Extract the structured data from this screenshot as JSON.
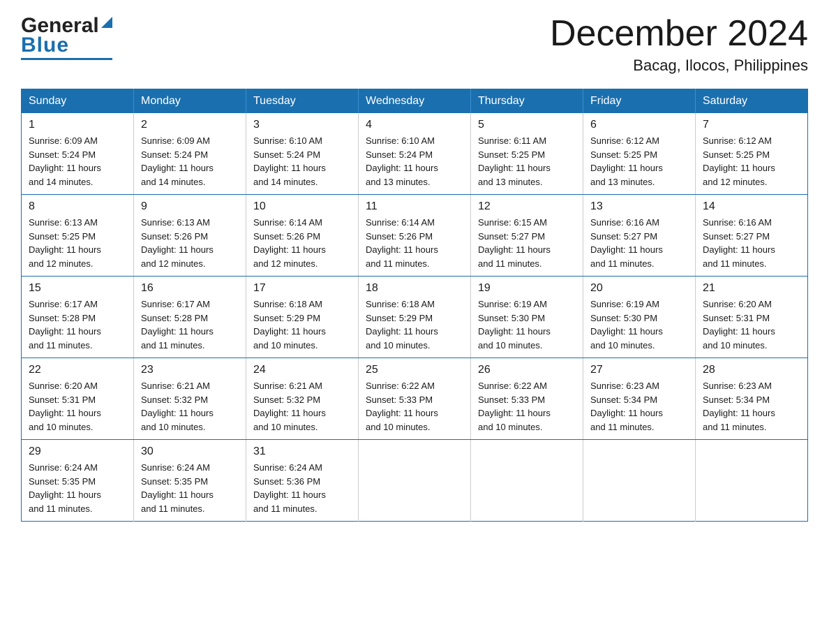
{
  "header": {
    "logo_general": "General",
    "logo_blue": "Blue",
    "month_title": "December 2024",
    "location": "Bacag, Ilocos, Philippines"
  },
  "days_of_week": [
    "Sunday",
    "Monday",
    "Tuesday",
    "Wednesday",
    "Thursday",
    "Friday",
    "Saturday"
  ],
  "weeks": [
    [
      {
        "day": "1",
        "sunrise": "6:09 AM",
        "sunset": "5:24 PM",
        "daylight": "11 hours and 14 minutes."
      },
      {
        "day": "2",
        "sunrise": "6:09 AM",
        "sunset": "5:24 PM",
        "daylight": "11 hours and 14 minutes."
      },
      {
        "day": "3",
        "sunrise": "6:10 AM",
        "sunset": "5:24 PM",
        "daylight": "11 hours and 14 minutes."
      },
      {
        "day": "4",
        "sunrise": "6:10 AM",
        "sunset": "5:24 PM",
        "daylight": "11 hours and 13 minutes."
      },
      {
        "day": "5",
        "sunrise": "6:11 AM",
        "sunset": "5:25 PM",
        "daylight": "11 hours and 13 minutes."
      },
      {
        "day": "6",
        "sunrise": "6:12 AM",
        "sunset": "5:25 PM",
        "daylight": "11 hours and 13 minutes."
      },
      {
        "day": "7",
        "sunrise": "6:12 AM",
        "sunset": "5:25 PM",
        "daylight": "11 hours and 12 minutes."
      }
    ],
    [
      {
        "day": "8",
        "sunrise": "6:13 AM",
        "sunset": "5:25 PM",
        "daylight": "11 hours and 12 minutes."
      },
      {
        "day": "9",
        "sunrise": "6:13 AM",
        "sunset": "5:26 PM",
        "daylight": "11 hours and 12 minutes."
      },
      {
        "day": "10",
        "sunrise": "6:14 AM",
        "sunset": "5:26 PM",
        "daylight": "11 hours and 12 minutes."
      },
      {
        "day": "11",
        "sunrise": "6:14 AM",
        "sunset": "5:26 PM",
        "daylight": "11 hours and 11 minutes."
      },
      {
        "day": "12",
        "sunrise": "6:15 AM",
        "sunset": "5:27 PM",
        "daylight": "11 hours and 11 minutes."
      },
      {
        "day": "13",
        "sunrise": "6:16 AM",
        "sunset": "5:27 PM",
        "daylight": "11 hours and 11 minutes."
      },
      {
        "day": "14",
        "sunrise": "6:16 AM",
        "sunset": "5:27 PM",
        "daylight": "11 hours and 11 minutes."
      }
    ],
    [
      {
        "day": "15",
        "sunrise": "6:17 AM",
        "sunset": "5:28 PM",
        "daylight": "11 hours and 11 minutes."
      },
      {
        "day": "16",
        "sunrise": "6:17 AM",
        "sunset": "5:28 PM",
        "daylight": "11 hours and 11 minutes."
      },
      {
        "day": "17",
        "sunrise": "6:18 AM",
        "sunset": "5:29 PM",
        "daylight": "11 hours and 10 minutes."
      },
      {
        "day": "18",
        "sunrise": "6:18 AM",
        "sunset": "5:29 PM",
        "daylight": "11 hours and 10 minutes."
      },
      {
        "day": "19",
        "sunrise": "6:19 AM",
        "sunset": "5:30 PM",
        "daylight": "11 hours and 10 minutes."
      },
      {
        "day": "20",
        "sunrise": "6:19 AM",
        "sunset": "5:30 PM",
        "daylight": "11 hours and 10 minutes."
      },
      {
        "day": "21",
        "sunrise": "6:20 AM",
        "sunset": "5:31 PM",
        "daylight": "11 hours and 10 minutes."
      }
    ],
    [
      {
        "day": "22",
        "sunrise": "6:20 AM",
        "sunset": "5:31 PM",
        "daylight": "11 hours and 10 minutes."
      },
      {
        "day": "23",
        "sunrise": "6:21 AM",
        "sunset": "5:32 PM",
        "daylight": "11 hours and 10 minutes."
      },
      {
        "day": "24",
        "sunrise": "6:21 AM",
        "sunset": "5:32 PM",
        "daylight": "11 hours and 10 minutes."
      },
      {
        "day": "25",
        "sunrise": "6:22 AM",
        "sunset": "5:33 PM",
        "daylight": "11 hours and 10 minutes."
      },
      {
        "day": "26",
        "sunrise": "6:22 AM",
        "sunset": "5:33 PM",
        "daylight": "11 hours and 10 minutes."
      },
      {
        "day": "27",
        "sunrise": "6:23 AM",
        "sunset": "5:34 PM",
        "daylight": "11 hours and 11 minutes."
      },
      {
        "day": "28",
        "sunrise": "6:23 AM",
        "sunset": "5:34 PM",
        "daylight": "11 hours and 11 minutes."
      }
    ],
    [
      {
        "day": "29",
        "sunrise": "6:24 AM",
        "sunset": "5:35 PM",
        "daylight": "11 hours and 11 minutes."
      },
      {
        "day": "30",
        "sunrise": "6:24 AM",
        "sunset": "5:35 PM",
        "daylight": "11 hours and 11 minutes."
      },
      {
        "day": "31",
        "sunrise": "6:24 AM",
        "sunset": "5:36 PM",
        "daylight": "11 hours and 11 minutes."
      },
      null,
      null,
      null,
      null
    ]
  ],
  "labels": {
    "sunrise": "Sunrise:",
    "sunset": "Sunset:",
    "daylight": "Daylight:"
  }
}
